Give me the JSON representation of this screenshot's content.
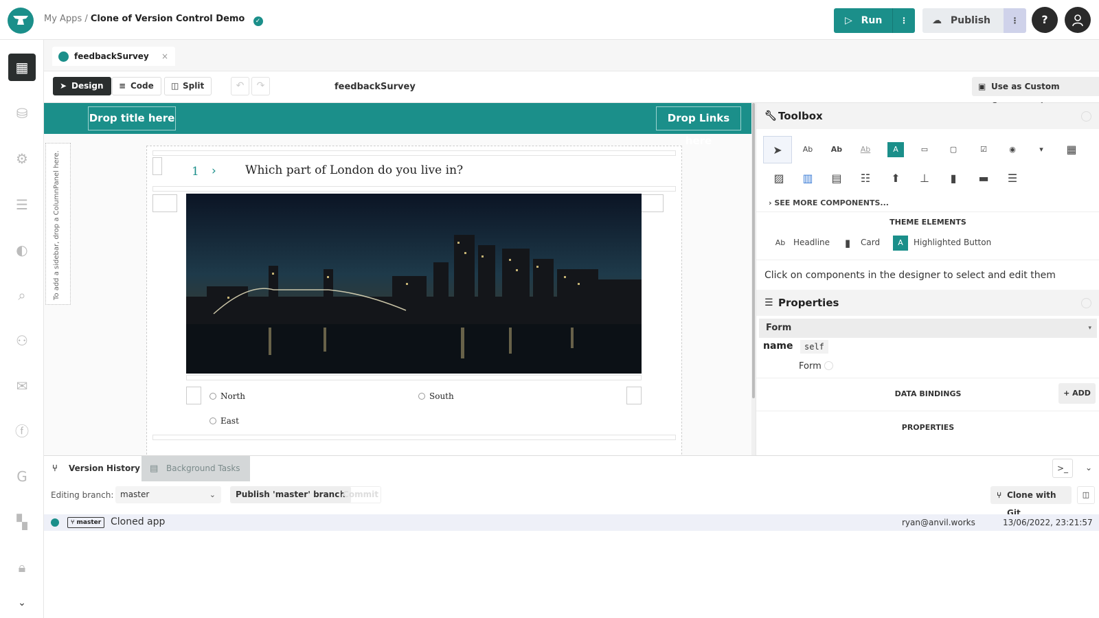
{
  "header": {
    "breadcrumb_root": "My Apps",
    "breadcrumb_sep": "/",
    "app_name": "Clone of Version Control Demo",
    "run_label": "Run",
    "publish_label": "Publish",
    "help_label": "?"
  },
  "rail": {
    "items": [
      "app-browser",
      "data-tables",
      "settings",
      "list",
      "theme",
      "search",
      "users",
      "email",
      "facebook",
      "google",
      "microsoft",
      "lock"
    ]
  },
  "editor": {
    "tab_label": "feedbackSurvey",
    "tab_close": "×",
    "modes": [
      "Design",
      "Code",
      "Split"
    ],
    "form_name": "feedbackSurvey",
    "custom_component_label": "Use as Custom Component..."
  },
  "canvas": {
    "drop_title": "Drop title here",
    "drop_links": "Drop Links here",
    "sidebar_hint": "To add a sidebar, drop a ColumnPanel here.",
    "question_number": "1",
    "question_chevron": "›",
    "question_text": "Which part of London do you live in?",
    "options": [
      "North",
      "South",
      "East"
    ]
  },
  "toolbox": {
    "title": "Toolbox",
    "see_more": "SEE MORE COMPONENTS...",
    "theme_title": "THEME ELEMENTS",
    "theme_items": [
      "Headline",
      "Card",
      "Highlighted Button"
    ],
    "hint": "Click on components in the designer to select and edit them"
  },
  "properties": {
    "title": "Properties",
    "form_row": "Form",
    "name_label": "name",
    "name_value": "self",
    "form_label": "Form",
    "data_bindings": "DATA BINDINGS",
    "add_label": "+ ADD",
    "properties_section": "PROPERTIES"
  },
  "bottom": {
    "tabs": [
      "Version History",
      "Background Tasks"
    ],
    "editing_branch_label": "Editing branch:",
    "branch_value": "master",
    "publish_branch_label": "Publish 'master' branch",
    "commit_label": "Commit",
    "clone_label": "Clone with Git",
    "commits": [
      {
        "branch": "master",
        "message": "Cloned app",
        "author": "ryan@anvil.works",
        "date": "13/06/2022, 23:21:57"
      }
    ]
  },
  "colors": {
    "accent": "#1b8f8a",
    "dark": "#2a2e2e"
  }
}
